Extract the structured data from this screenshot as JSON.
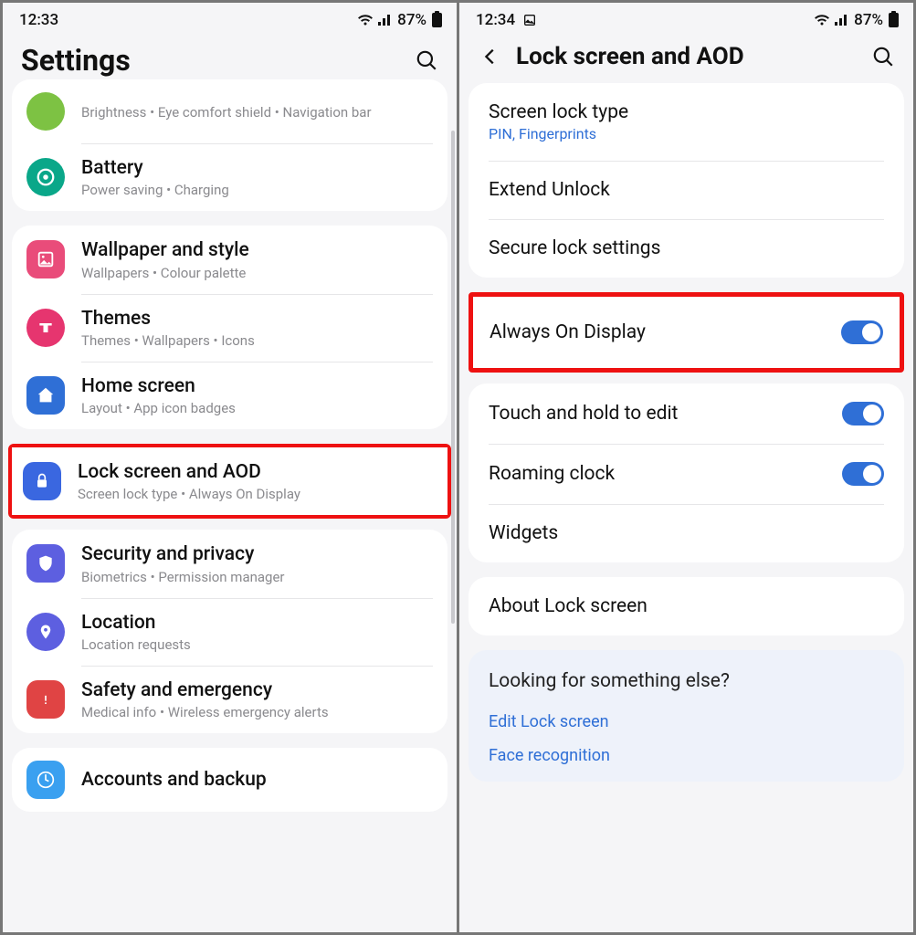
{
  "left": {
    "status": {
      "time": "12:33",
      "battery": "87%"
    },
    "title": "Settings",
    "groups": [
      {
        "rows": [
          {
            "icon": "display-icon",
            "sub": "Brightness  •  Eye comfort shield  •  Navigation bar",
            "partial": true
          },
          {
            "icon": "battery-icon",
            "title": "Battery",
            "sub": "Power saving  •  Charging"
          }
        ]
      },
      {
        "rows": [
          {
            "icon": "wallpaper-icon",
            "title": "Wallpaper and style",
            "sub": "Wallpapers  •  Colour palette"
          },
          {
            "icon": "themes-icon",
            "title": "Themes",
            "sub": "Themes  •  Wallpapers  •  Icons"
          },
          {
            "icon": "home-icon",
            "title": "Home screen",
            "sub": "Layout  •  App icon badges"
          },
          {
            "icon": "lock-icon",
            "title": "Lock screen and AOD",
            "sub": "Screen lock type  •  Always On Display",
            "highlight": true
          }
        ]
      },
      {
        "rows": [
          {
            "icon": "shield-icon",
            "title": "Security and privacy",
            "sub": "Biometrics  •  Permission manager"
          },
          {
            "icon": "location-icon",
            "title": "Location",
            "sub": "Location requests"
          },
          {
            "icon": "emergency-icon",
            "title": "Safety and emergency",
            "sub": "Medical info  •  Wireless emergency alerts"
          }
        ]
      },
      {
        "rows": [
          {
            "icon": "accounts-icon",
            "title": "Accounts and backup",
            "partial_bottom": true
          }
        ]
      }
    ]
  },
  "right": {
    "status": {
      "time": "12:34",
      "battery": "87%"
    },
    "title": "Lock screen and AOD",
    "card1": [
      {
        "title": "Screen lock type",
        "sub": "PIN, Fingerprints"
      },
      {
        "title": "Extend Unlock"
      },
      {
        "title": "Secure lock settings"
      }
    ],
    "aod": {
      "title": "Always On Display",
      "toggle": true
    },
    "card2": [
      {
        "title": "Touch and hold to edit",
        "toggle": true
      },
      {
        "title": "Roaming clock",
        "toggle": true
      },
      {
        "title": "Widgets"
      }
    ],
    "card3": [
      {
        "title": "About Lock screen"
      }
    ],
    "footer": {
      "title": "Looking for something else?",
      "links": [
        "Edit Lock screen",
        "Face recognition"
      ]
    }
  }
}
